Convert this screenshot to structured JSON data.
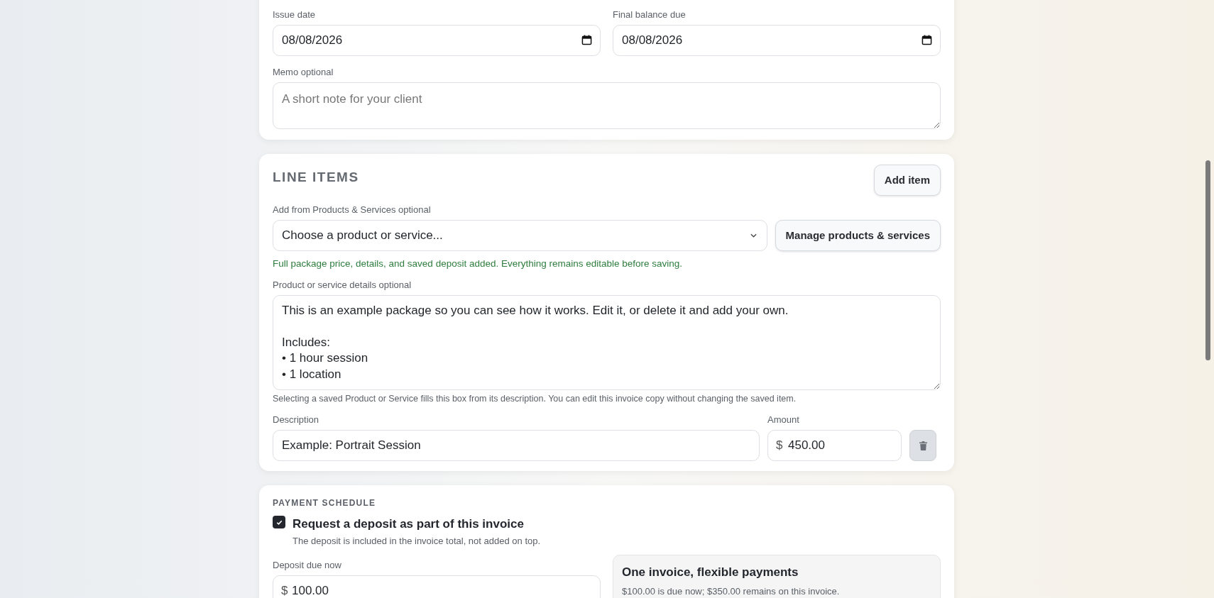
{
  "dates": [
    {
      "label": "Issue date",
      "value": "08/08/2026"
    },
    {
      "label": "Final balance due",
      "value": "08/08/2026"
    }
  ],
  "memo": {
    "label": "Memo",
    "optional": "optional",
    "placeholder": "A short note for your client"
  },
  "line_items": {
    "title": "LINE ITEMS",
    "add_button": "Add item",
    "catalog": {
      "label": "Add from Products & Services",
      "optional": "optional",
      "value": "Choose a product or service...",
      "manage_button": "Manage products & services"
    },
    "notice": "Full package price, details, and saved deposit added. Everything remains editable before saving.",
    "details": {
      "label": "Product or service details",
      "optional": "optional",
      "value": "This is an example package so you can see how it works. Edit it, or delete it and add your own.\n\nIncludes:\n• 1 hour session\n• 1 location"
    },
    "details_help": "Selecting a saved Product or Service fills this box from its description. You can edit this invoice copy without changing the saved item.",
    "items": [
      {
        "description_label": "Description",
        "description": "Example: Portrait Session",
        "amount_label": "Amount",
        "currency": "$",
        "amount": "450.00"
      }
    ]
  },
  "payment_schedule": {
    "title": "PAYMENT SCHEDULE",
    "deposit_toggle": {
      "label": "Request a deposit as part of this invoice",
      "hint": "The deposit is included in the invoice total, not added on top.",
      "checked": true
    },
    "deposit": {
      "label": "Deposit due now",
      "currency": "$",
      "value": "100.00"
    },
    "summary": {
      "title": "One invoice, flexible payments",
      "text": "$100.00 is due now; $350.00 remains on this invoice."
    }
  }
}
